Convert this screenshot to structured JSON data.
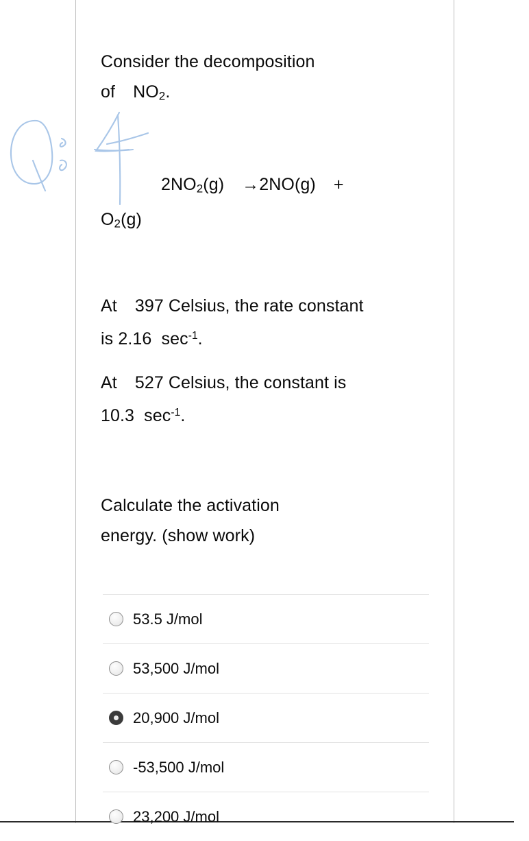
{
  "document": {
    "intro": {
      "line1": "Consider   the   decomposition",
      "line2_prefix": "of",
      "formula": "NO",
      "formula_sub": "2",
      "line2_suffix": "."
    },
    "equation": {
      "reactant_coeff": "2NO",
      "reactant_sub": "2",
      "reactant_state": "(g)",
      "arrow": "→",
      "product_coeff": "2NO",
      "product_state": "(g)",
      "plus": "+",
      "product2": "O",
      "product2_sub": "2",
      "product2_state": "(g)"
    },
    "condition1": {
      "lead": "At",
      "temperature": "397",
      "unit": "Celsius, the rate  constant",
      "value_lead": "is",
      "value": "2.16",
      "value_unit": "sec",
      "value_exponent": "-1",
      "period": "."
    },
    "condition2": {
      "lead": "At",
      "temperature": "527",
      "unit": "Celsius, the constant is",
      "value": "10.3",
      "value_unit": "sec",
      "value_exponent": "-1",
      "period": "."
    },
    "question": {
      "line1": "Calculate   the   activation",
      "line2": "energy.  (show work)"
    }
  },
  "options": [
    {
      "label": "53.5 J/mol",
      "selected": false
    },
    {
      "label": "53,500 J/mol",
      "selected": false
    },
    {
      "label": "20,900 J/mol",
      "selected": true
    },
    {
      "label": "-53,500 J/mol",
      "selected": false
    },
    {
      "label": "23,200 J/mol",
      "selected": false
    }
  ],
  "annotations": {
    "margin_mark": "Q",
    "inline_mark": "4"
  },
  "colors": {
    "ink": "#a9c6e8",
    "rule": "#bdbdbd",
    "divider": "#e2e2e2",
    "scrollbar": "#757575",
    "text": "#0a0a0a"
  }
}
